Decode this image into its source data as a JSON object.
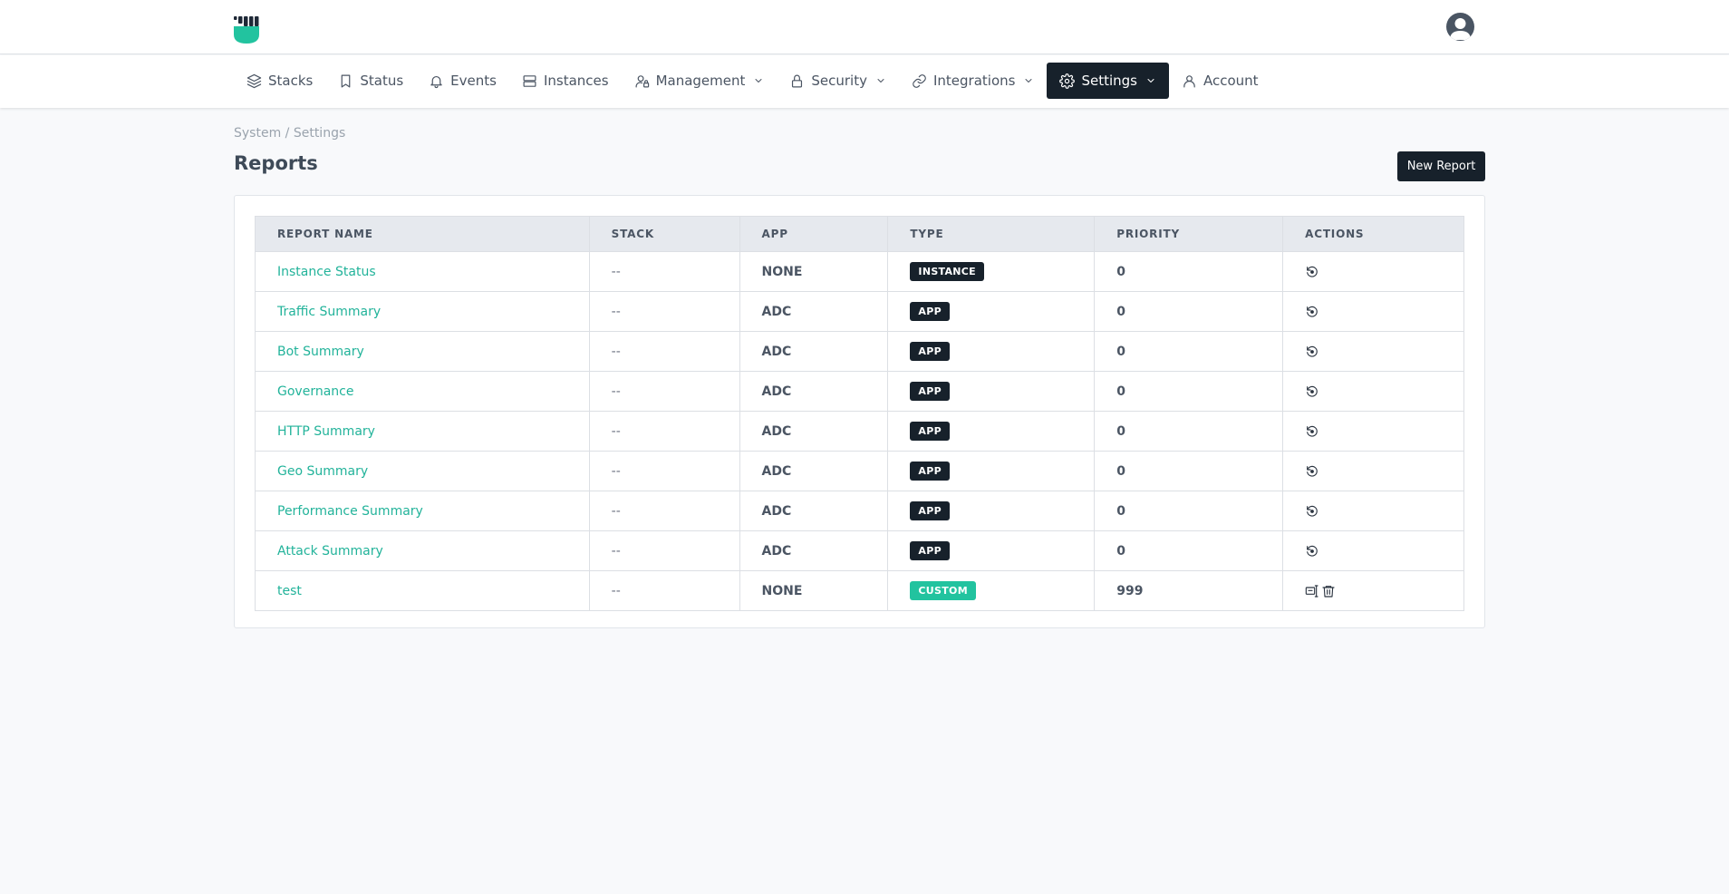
{
  "nav": {
    "items": [
      {
        "label": "Stacks",
        "icon": "layers-icon"
      },
      {
        "label": "Status",
        "icon": "bookmark-icon"
      },
      {
        "label": "Events",
        "icon": "bell-icon"
      },
      {
        "label": "Instances",
        "icon": "server-icon"
      },
      {
        "label": "Management",
        "icon": "user-lock-icon",
        "dropdown": true
      },
      {
        "label": "Security",
        "icon": "lock-icon",
        "dropdown": true
      },
      {
        "label": "Integrations",
        "icon": "link-icon",
        "dropdown": true
      },
      {
        "label": "Settings",
        "icon": "gear-icon",
        "dropdown": true,
        "active": true
      },
      {
        "label": "Account",
        "icon": "user-icon"
      }
    ]
  },
  "breadcrumb": "System / Settings",
  "page": {
    "title": "Reports",
    "new_button": "New Report"
  },
  "table": {
    "headers": [
      "REPORT NAME",
      "STACK",
      "APP",
      "TYPE",
      "PRIORITY",
      "ACTIONS"
    ],
    "rows": [
      {
        "name": "Instance Status",
        "stack": "--",
        "app": "NONE",
        "type": "INSTANCE",
        "priority": "0",
        "actions": [
          "reset-icon"
        ]
      },
      {
        "name": "Traffic Summary",
        "stack": "--",
        "app": "ADC",
        "type": "APP",
        "priority": "0",
        "actions": [
          "reset-icon"
        ]
      },
      {
        "name": "Bot Summary",
        "stack": "--",
        "app": "ADC",
        "type": "APP",
        "priority": "0",
        "actions": [
          "reset-icon"
        ]
      },
      {
        "name": "Governance",
        "stack": "--",
        "app": "ADC",
        "type": "APP",
        "priority": "0",
        "actions": [
          "reset-icon"
        ]
      },
      {
        "name": "HTTP Summary",
        "stack": "--",
        "app": "ADC",
        "type": "APP",
        "priority": "0",
        "actions": [
          "reset-icon"
        ]
      },
      {
        "name": "Geo Summary",
        "stack": "--",
        "app": "ADC",
        "type": "APP",
        "priority": "0",
        "actions": [
          "reset-icon"
        ]
      },
      {
        "name": "Performance Summary",
        "stack": "--",
        "app": "ADC",
        "type": "APP",
        "priority": "0",
        "actions": [
          "reset-icon"
        ]
      },
      {
        "name": "Attack Summary",
        "stack": "--",
        "app": "ADC",
        "type": "APP",
        "priority": "0",
        "actions": [
          "reset-icon"
        ]
      },
      {
        "name": "test",
        "stack": "--",
        "app": "NONE",
        "type": "CUSTOM",
        "priority": "999",
        "actions": [
          "edit-icon",
          "trash-icon"
        ]
      }
    ]
  },
  "colors": {
    "accent": "#22b39a",
    "dark": "#17212b",
    "custom_badge": "#22c39f"
  }
}
